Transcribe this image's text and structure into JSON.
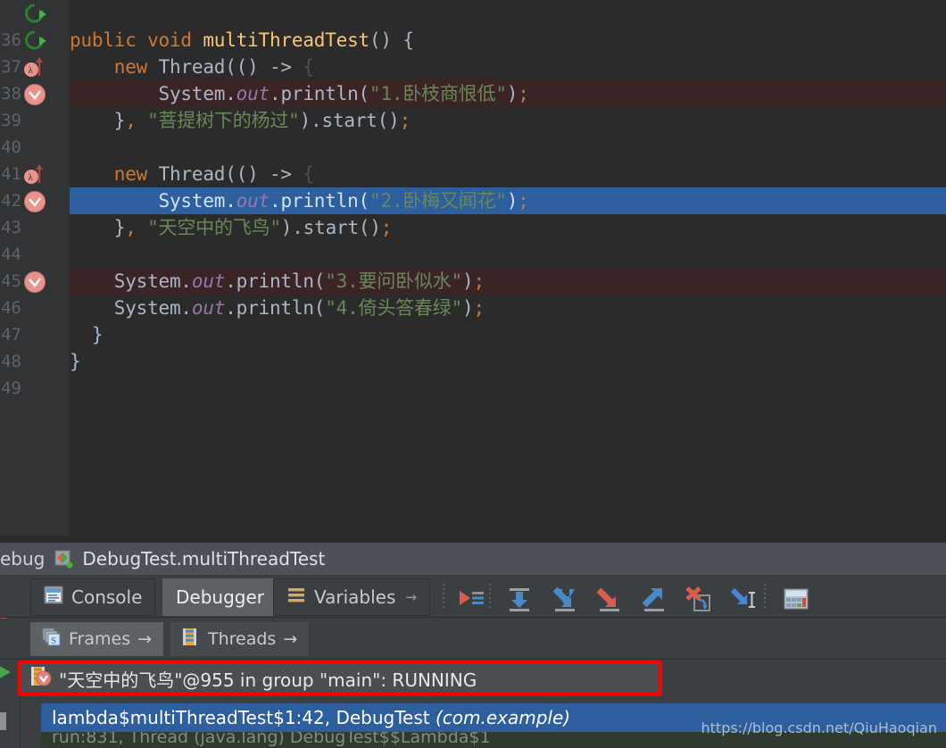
{
  "editor": {
    "first_line_number": 36,
    "lines": [
      {
        "num": 36,
        "indent": 0,
        "marker": "rerun-icon",
        "highlight": "none",
        "tokens": [
          {
            "t": "plain",
            "v": "     "
          }
        ]
      },
      {
        "num": 36,
        "indent": 0,
        "marker": "rerun-icon",
        "highlight": "none",
        "tokens": [
          {
            "t": "kw",
            "v": "public void "
          },
          {
            "t": "mth",
            "v": "multiThreadTest"
          },
          {
            "t": "punc",
            "v": "() {"
          }
        ]
      },
      {
        "num": 37,
        "indent": 0,
        "marker": "lambda-breakpoint-icon",
        "highlight": "none",
        "tokens": [
          {
            "t": "plain",
            "v": "    "
          },
          {
            "t": "kw",
            "v": "new "
          },
          {
            "t": "plain",
            "v": "Thread(() -> "
          },
          {
            "t": "brace-ghost",
            "v": "{"
          }
        ]
      },
      {
        "num": 38,
        "indent": 0,
        "marker": "breakpoint-done-icon",
        "highlight": "bp",
        "tokens": [
          {
            "t": "plain",
            "v": "        System."
          },
          {
            "t": "fld",
            "v": "out"
          },
          {
            "t": "plain",
            "v": ".println("
          },
          {
            "t": "str",
            "v": "\"1.卧枝商恨低\""
          },
          {
            "t": "plain",
            "v": ")"
          },
          {
            "t": "semi",
            "v": ";"
          }
        ]
      },
      {
        "num": 39,
        "indent": 0,
        "marker": "none",
        "highlight": "none",
        "tokens": [
          {
            "t": "plain",
            "v": "    }"
          },
          {
            "t": "semi",
            "v": ", "
          },
          {
            "t": "str",
            "v": "\"菩提树下的杨过\""
          },
          {
            "t": "plain",
            "v": ").start()"
          },
          {
            "t": "semi",
            "v": ";"
          }
        ]
      },
      {
        "num": 40,
        "indent": 0,
        "marker": "none",
        "highlight": "none",
        "tokens": []
      },
      {
        "num": 41,
        "indent": 0,
        "marker": "lambda-breakpoint-icon",
        "highlight": "none",
        "tokens": [
          {
            "t": "plain",
            "v": "    "
          },
          {
            "t": "kw",
            "v": "new "
          },
          {
            "t": "plain",
            "v": "Thread(() -> "
          },
          {
            "t": "brace-ghost",
            "v": "{"
          }
        ]
      },
      {
        "num": 42,
        "indent": 0,
        "marker": "breakpoint-done-icon",
        "highlight": "sel",
        "tokens": [
          {
            "t": "plain",
            "v": "        System."
          },
          {
            "t": "fld",
            "v": "out"
          },
          {
            "t": "plain",
            "v": ".println("
          },
          {
            "t": "str",
            "v": "\"2.卧梅又闻花\""
          },
          {
            "t": "plain",
            "v": ")"
          },
          {
            "t": "semi",
            "v": ";"
          }
        ]
      },
      {
        "num": 43,
        "indent": 0,
        "marker": "none",
        "highlight": "none",
        "tokens": [
          {
            "t": "plain",
            "v": "    }"
          },
          {
            "t": "semi",
            "v": ", "
          },
          {
            "t": "str",
            "v": "\"天空中的飞鸟\""
          },
          {
            "t": "plain",
            "v": ").start()"
          },
          {
            "t": "semi",
            "v": ";"
          }
        ]
      },
      {
        "num": 44,
        "indent": 0,
        "marker": "none",
        "highlight": "none",
        "tokens": []
      },
      {
        "num": 45,
        "indent": 0,
        "marker": "breakpoint-done-icon",
        "highlight": "bp",
        "tokens": [
          {
            "t": "plain",
            "v": "    System."
          },
          {
            "t": "fld",
            "v": "out"
          },
          {
            "t": "plain",
            "v": ".println("
          },
          {
            "t": "str",
            "v": "\"3.要问卧似水\""
          },
          {
            "t": "plain",
            "v": ")"
          },
          {
            "t": "semi",
            "v": ";"
          }
        ]
      },
      {
        "num": 46,
        "indent": 0,
        "marker": "none",
        "highlight": "none",
        "tokens": [
          {
            "t": "plain",
            "v": "    System."
          },
          {
            "t": "fld",
            "v": "out"
          },
          {
            "t": "plain",
            "v": ".println("
          },
          {
            "t": "str",
            "v": "\"4.倚头答春绿\""
          },
          {
            "t": "plain",
            "v": ")"
          },
          {
            "t": "semi",
            "v": ";"
          }
        ]
      },
      {
        "num": 47,
        "indent": 0,
        "marker": "none",
        "highlight": "none",
        "tokens": [
          {
            "t": "plain",
            "v": "  }"
          }
        ]
      },
      {
        "num": 48,
        "indent": 0,
        "marker": "none",
        "highlight": "none",
        "tokens": [
          {
            "t": "plain",
            "v": "}"
          }
        ]
      },
      {
        "num": 49,
        "indent": 0,
        "marker": "none",
        "highlight": "none",
        "tokens": []
      }
    ]
  },
  "debug": {
    "titlebar": {
      "tool_word": "ebug",
      "config_icon": "debug-config-icon",
      "run_config_name": "DebugTest.multiThreadTest"
    },
    "tabs": [
      {
        "label": "Console",
        "icon": "console-icon",
        "active": false,
        "arrow": ""
      },
      {
        "label": "Debugger",
        "icon": "none",
        "active": true,
        "arrow": ""
      },
      {
        "label": "Variables",
        "icon": "variables-icon",
        "active": false,
        "arrow": "→"
      }
    ],
    "toolbar_icons": [
      "show-execution-point-icon",
      "step-over-icon",
      "step-into-icon",
      "force-step-into-icon",
      "step-out-icon",
      "drop-frame-icon",
      "run-to-cursor-icon",
      "evaluate-expression-icon"
    ],
    "subtabs": [
      {
        "label": "Frames",
        "icon": "frames-icon",
        "active": true,
        "arrow": "→"
      },
      {
        "label": "Threads",
        "icon": "threads-icon",
        "active": false,
        "arrow": "→"
      }
    ],
    "left_rail_icons": [
      "resume-program-icon",
      "mute-breakpoints-icon",
      "rerun-icon",
      "stop-icon"
    ],
    "thread_row": {
      "icon": "thread-suspended-icon",
      "text": "\"天空中的飞鸟\"@955 in group \"main\": RUNNING",
      "highlight_color": "#ff0000"
    },
    "frame_row": {
      "method": "lambda$multiThreadTest$1:42, DebugTest ",
      "package": "(com.example)",
      "selected_color": "#2d5f9e"
    },
    "frame_row_partial": {
      "text": "run:831, Thread (java.lang) DebugTest$$Lambda$1"
    }
  },
  "watermark": {
    "text": "https://blog.csdn.net/QiuHaoqian"
  },
  "colors": {
    "editor_bg": "#2b2b2b",
    "gutter_bg": "#313335",
    "panel_bg": "#3c3f41",
    "titlebar_bg": "#4b5059",
    "selection_blue": "#2d5f9e",
    "breakpoint_line": "#3b2426",
    "keyword_orange": "#cc7832",
    "method_yellow": "#ffc66d",
    "string_green": "#6a8759",
    "field_purple": "#9876aa",
    "text_gray": "#a9b7c6"
  }
}
